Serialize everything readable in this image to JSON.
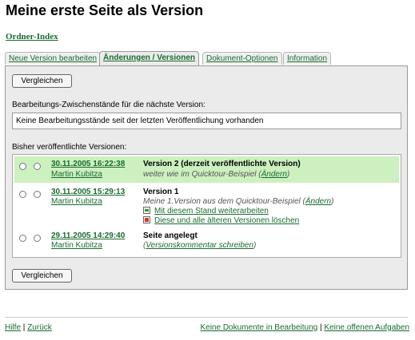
{
  "page": {
    "title": "Meine erste Seite als Version",
    "folder_link": "Ordner-Index"
  },
  "tabs": [
    {
      "label": "Neue Version bearbeiten",
      "active": false
    },
    {
      "label": "Änderungen / Versionen",
      "active": true
    },
    {
      "label": "Dokument-Optionen",
      "active": false
    },
    {
      "label": "Information",
      "active": false
    }
  ],
  "panel": {
    "compare_label": "Vergleichen",
    "drafts_label": "Bearbeitungs-Zwischenstände für die nächste Version:",
    "drafts_value": "Keine Bearbeitungsstände seit der letzten Veröffentlichung vorhanden",
    "published_label": "Bisher veröffentlichte Versionen:"
  },
  "versions": [
    {
      "date": "30.11.2005 16:22:38",
      "author": "Martin Kubitza",
      "title": "Version 2 (derzeit veröffentlichte Version)",
      "comment": "weiter wie im Quicktour-Beispiel",
      "comment_link": "Ändern",
      "current": true
    },
    {
      "date": "30.11.2005 15:29:13",
      "author": "Martin Kubitza",
      "title": "Version 1",
      "comment": "Meine 1.Version aus dem Quicktour-Beispiel",
      "comment_link": "Ändern",
      "actions": [
        {
          "icon": "continue-icon",
          "label": "Mit diesem Stand weiterarbeiten"
        },
        {
          "icon": "delete-icon",
          "label": "Diese und alle älteren Versionen löschen"
        }
      ],
      "current": false
    },
    {
      "date": "29.11.2005 14:29:40",
      "author": "Martin Kubitza",
      "title": "Seite angelegt",
      "comment_link": "Versionskommentar schreiben",
      "current": false
    }
  ],
  "footer": {
    "help": "Hilfe",
    "back": "Zurück",
    "no_documents": "Keine Dokumente in Bearbeitung",
    "no_tasks": "Keine offenen Aufgaben",
    "separator": "|"
  },
  "colors": {
    "link": "#1a6b30",
    "current_version_bg": "#ccf0c0",
    "panel_bg": "#ebebeb"
  }
}
